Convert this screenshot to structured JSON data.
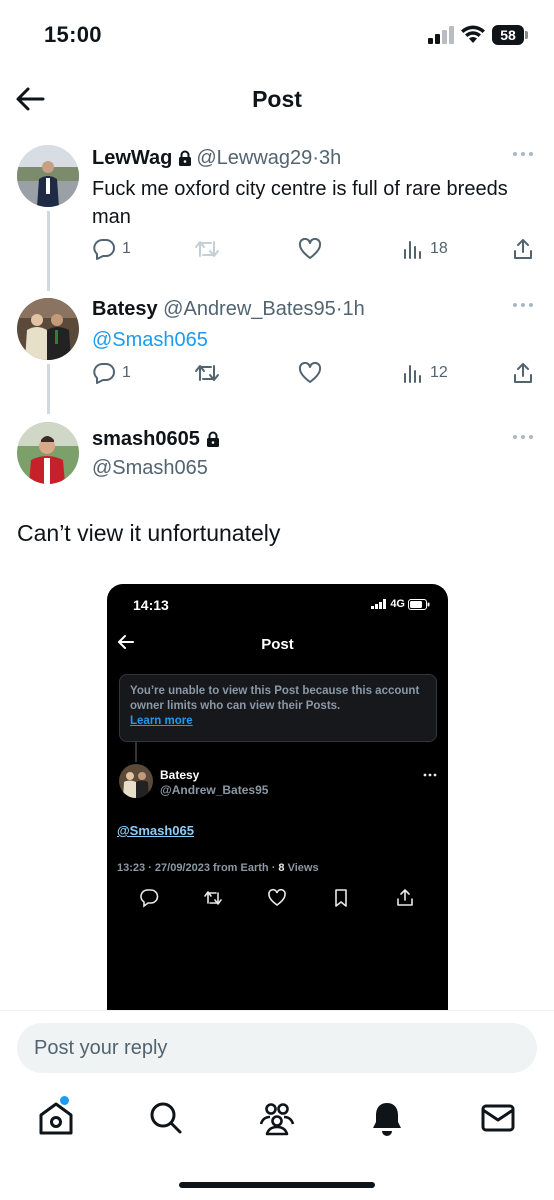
{
  "status_bar": {
    "time": "15:00",
    "battery": "58"
  },
  "header": {
    "title": "Post"
  },
  "tweets": [
    {
      "name": "LewWag",
      "handle": "@Lewwag29",
      "separator": "·",
      "time": "3h",
      "text": "Fuck me oxford city centre is full of rare breeds man",
      "replies": "1",
      "retweets": "",
      "views": "18",
      "locked": true
    },
    {
      "name": "Batesy",
      "handle": "@Andrew_Bates95",
      "separator": "·",
      "time": "1h",
      "text": "@Smash065",
      "replies": "1",
      "retweets": "",
      "views": "12",
      "locked": false
    },
    {
      "name": "smash0605",
      "handle": "@Smash065",
      "locked": true,
      "body": "Can’t view it unfortunately"
    }
  ],
  "embedded_screenshot": {
    "time": "14:13",
    "network": "4G",
    "title": "Post",
    "notice": "You’re unable to view this Post because this account owner limits who can view their Posts.",
    "notice_link": "Learn more",
    "name": "Batesy",
    "handle": "@Andrew_Bates95",
    "mention": "@Smash065",
    "meta": "13:23 · 27/09/2023 from Earth · ",
    "views_count": "8",
    "views_label": " Views"
  },
  "reply_bar": {
    "placeholder": "Post your reply"
  },
  "nav": {
    "items": [
      "home-icon",
      "search-icon",
      "communities-icon",
      "notifications-icon",
      "messages-icon"
    ],
    "accent": "#1d9bf0"
  },
  "colors": {
    "link": "#1d9bf0",
    "muted": "#536471",
    "text": "#0f1419"
  }
}
